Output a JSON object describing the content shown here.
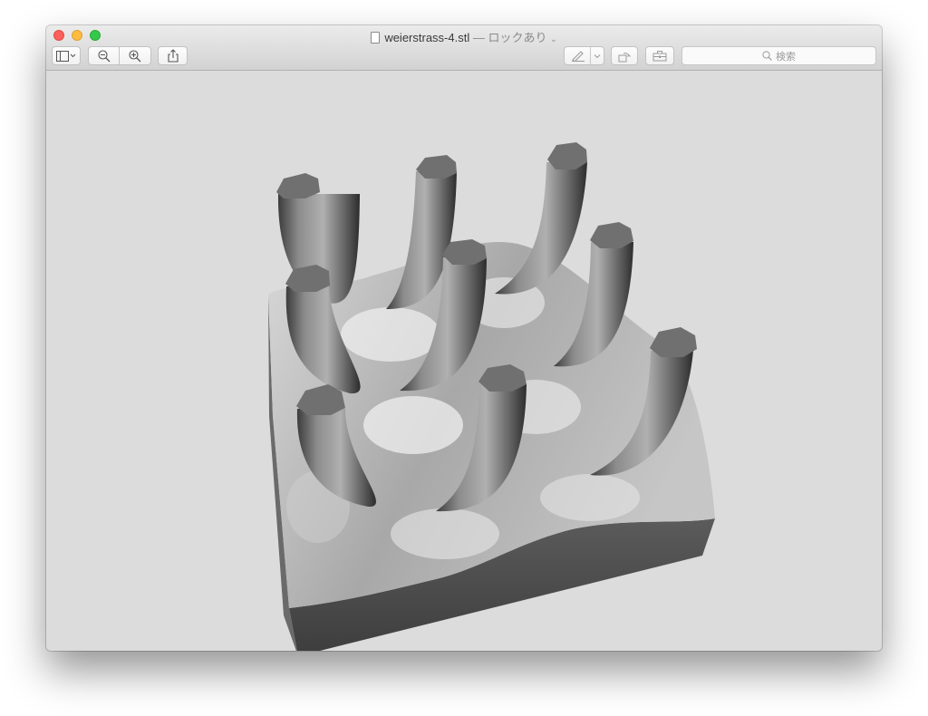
{
  "window": {
    "filename": "weierstrass-4.stl",
    "separator": "—",
    "lock_status": "ロックあり",
    "chevron": "⌄"
  },
  "toolbar": {
    "sidebar_button": "sidebar-toggle",
    "zoom_out_button": "zoom-out",
    "zoom_in_button": "zoom-in",
    "share_button": "share",
    "markup_button": "markup",
    "rotate_button": "rotate",
    "toolbox_button": "toolbox"
  },
  "search": {
    "placeholder": "検索"
  },
  "colors": {
    "close": "#fc605c",
    "minimize": "#fdbc40",
    "maximize": "#34c84a",
    "canvas": "#dcdcdc",
    "model_base": "#4a4a4a",
    "model_top": "#6e6e6e"
  },
  "icons": [
    "file-icon",
    "sidebar-icon",
    "zoom-out-icon",
    "zoom-in-icon",
    "share-icon",
    "pen-icon",
    "rotate-icon",
    "toolbox-icon",
    "search-icon"
  ]
}
